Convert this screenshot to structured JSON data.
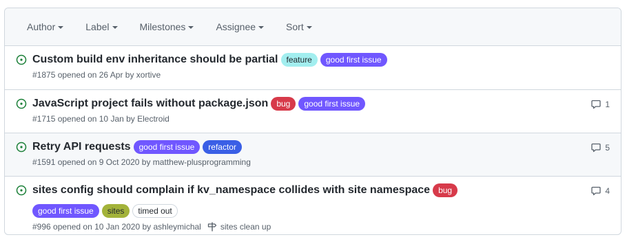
{
  "filters": [
    "Author",
    "Label",
    "Milestones",
    "Assignee",
    "Sort"
  ],
  "colors": {
    "open_icon": "#1a7f37",
    "feature": "#a2eeef",
    "good_first_issue": "#7057ff",
    "bug": "#d73a4a",
    "refactor": "#3a5fe6",
    "sites": "#a3b33a",
    "timed_out": "#ffffff"
  },
  "issues": [
    {
      "title": "Custom build env inheritance should be partial",
      "labels": [
        "feature",
        "good first issue"
      ],
      "meta": "#1875 opened on 26 Apr by xortive",
      "comments": ""
    },
    {
      "title": "JavaScript project fails without package.json",
      "labels": [
        "bug",
        "good first issue"
      ],
      "meta": "#1715 opened on 10 Jan by Electroid",
      "comments": "1"
    },
    {
      "title": "Retry API requests",
      "labels": [
        "good first issue",
        "refactor"
      ],
      "meta": "#1591 opened on 9 Oct 2020 by matthew-plusprogramming",
      "comments": "5"
    },
    {
      "title": "sites config should complain if kv_namespace collides with site namespace",
      "labels": [
        "bug",
        "good first issue",
        "sites",
        "timed out"
      ],
      "meta": "#996 opened on 10 Jan 2020 by ashleymichal",
      "milestone": "sites clean up",
      "comments": "4"
    }
  ]
}
